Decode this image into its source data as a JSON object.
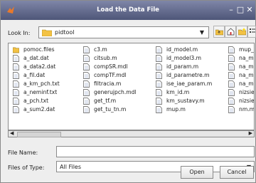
{
  "window": {
    "title": "Load the Data File",
    "min": "–",
    "max": "□",
    "close": "✕"
  },
  "lookin": {
    "label": "Look In:",
    "value": "pidtool"
  },
  "files": {
    "col1": [
      "pomoc.files",
      "a_dat.dat",
      "a_data2.dat",
      "a_fil.dat",
      "a_km_pch.txt",
      "a_neminf.txt",
      "a_pch.txt",
      "a_sum2.dat"
    ],
    "col2": [
      "c3.m",
      "citsub.m",
      "compSR.mdl",
      "compTF.mdl",
      "filtracia.m",
      "generujpch.mdl",
      "get_tf.m",
      "get_tu_tn.m"
    ],
    "col3": [
      "id_model.m",
      "id_model3.m",
      "id_param.m",
      "id_parametre.m",
      "ise_iae_param.m",
      "km_id.m",
      "km_sustavy.m",
      "mup.m"
    ],
    "col4": [
      "mup_i",
      "na_mc",
      "na_mc",
      "na_mc",
      "na_mc",
      "nizsie",
      "nizsie",
      "nm.m"
    ]
  },
  "filename": {
    "label": "File Name:",
    "value": ""
  },
  "filetype": {
    "label": "Files of Type:",
    "value": "All Files"
  },
  "buttons": {
    "open": "Open",
    "cancel": "Cancel"
  }
}
